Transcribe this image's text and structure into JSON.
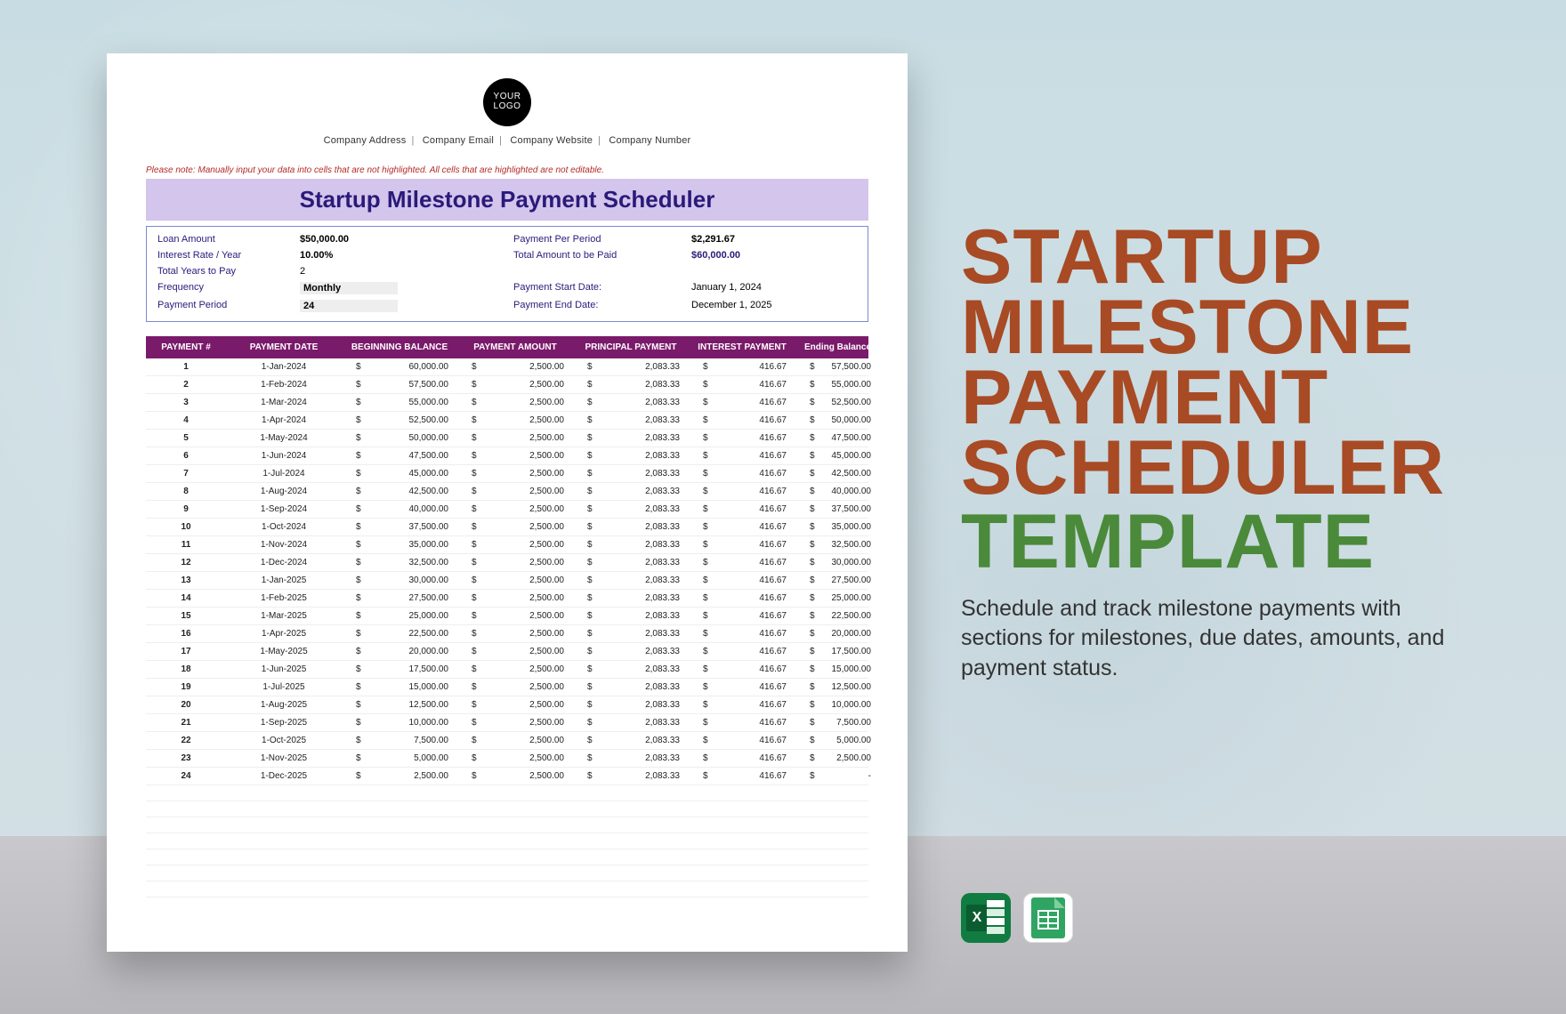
{
  "logo_text": "YOUR LOGO",
  "company_meta": [
    "Company Address",
    "Company Email",
    "Company Website",
    "Company Number"
  ],
  "note": "Please note: Manually input your data into cells that are not highlighted. All cells that are highlighted are not editable.",
  "sheet_title": "Startup Milestone Payment Scheduler",
  "summary": {
    "loan_amount_label": "Loan Amount",
    "loan_amount": "$50,000.00",
    "interest_label": "Interest Rate / Year",
    "interest": "10.00%",
    "years_label": "Total Years to Pay",
    "years": "2",
    "freq_label": "Frequency",
    "freq": "Monthly",
    "period_label": "Payment Period",
    "period": "24",
    "ppp_label": "Payment Per Period",
    "ppp": "$2,291.67",
    "total_label": "Total Amount to be Paid",
    "total": "$60,000.00",
    "start_label": "Payment Start Date:",
    "start": "January 1, 2024",
    "end_label": "Payment End Date:",
    "end": "December 1, 2025"
  },
  "columns": [
    "PAYMENT #",
    "PAYMENT DATE",
    "BEGINNING BALANCE",
    "PAYMENT AMOUNT",
    "PRINCIPAL PAYMENT",
    "INTEREST PAYMENT",
    "Ending Balance"
  ],
  "currency": "$",
  "rows": [
    {
      "n": "1",
      "date": "1-Jan-2024",
      "beg": "60,000.00",
      "pay": "2,500.00",
      "prin": "2,083.33",
      "int": "416.67",
      "end": "57,500.00"
    },
    {
      "n": "2",
      "date": "1-Feb-2024",
      "beg": "57,500.00",
      "pay": "2,500.00",
      "prin": "2,083.33",
      "int": "416.67",
      "end": "55,000.00"
    },
    {
      "n": "3",
      "date": "1-Mar-2024",
      "beg": "55,000.00",
      "pay": "2,500.00",
      "prin": "2,083.33",
      "int": "416.67",
      "end": "52,500.00"
    },
    {
      "n": "4",
      "date": "1-Apr-2024",
      "beg": "52,500.00",
      "pay": "2,500.00",
      "prin": "2,083.33",
      "int": "416.67",
      "end": "50,000.00"
    },
    {
      "n": "5",
      "date": "1-May-2024",
      "beg": "50,000.00",
      "pay": "2,500.00",
      "prin": "2,083.33",
      "int": "416.67",
      "end": "47,500.00"
    },
    {
      "n": "6",
      "date": "1-Jun-2024",
      "beg": "47,500.00",
      "pay": "2,500.00",
      "prin": "2,083.33",
      "int": "416.67",
      "end": "45,000.00"
    },
    {
      "n": "7",
      "date": "1-Jul-2024",
      "beg": "45,000.00",
      "pay": "2,500.00",
      "prin": "2,083.33",
      "int": "416.67",
      "end": "42,500.00"
    },
    {
      "n": "8",
      "date": "1-Aug-2024",
      "beg": "42,500.00",
      "pay": "2,500.00",
      "prin": "2,083.33",
      "int": "416.67",
      "end": "40,000.00"
    },
    {
      "n": "9",
      "date": "1-Sep-2024",
      "beg": "40,000.00",
      "pay": "2,500.00",
      "prin": "2,083.33",
      "int": "416.67",
      "end": "37,500.00"
    },
    {
      "n": "10",
      "date": "1-Oct-2024",
      "beg": "37,500.00",
      "pay": "2,500.00",
      "prin": "2,083.33",
      "int": "416.67",
      "end": "35,000.00"
    },
    {
      "n": "11",
      "date": "1-Nov-2024",
      "beg": "35,000.00",
      "pay": "2,500.00",
      "prin": "2,083.33",
      "int": "416.67",
      "end": "32,500.00"
    },
    {
      "n": "12",
      "date": "1-Dec-2024",
      "beg": "32,500.00",
      "pay": "2,500.00",
      "prin": "2,083.33",
      "int": "416.67",
      "end": "30,000.00"
    },
    {
      "n": "13",
      "date": "1-Jan-2025",
      "beg": "30,000.00",
      "pay": "2,500.00",
      "prin": "2,083.33",
      "int": "416.67",
      "end": "27,500.00"
    },
    {
      "n": "14",
      "date": "1-Feb-2025",
      "beg": "27,500.00",
      "pay": "2,500.00",
      "prin": "2,083.33",
      "int": "416.67",
      "end": "25,000.00"
    },
    {
      "n": "15",
      "date": "1-Mar-2025",
      "beg": "25,000.00",
      "pay": "2,500.00",
      "prin": "2,083.33",
      "int": "416.67",
      "end": "22,500.00"
    },
    {
      "n": "16",
      "date": "1-Apr-2025",
      "beg": "22,500.00",
      "pay": "2,500.00",
      "prin": "2,083.33",
      "int": "416.67",
      "end": "20,000.00"
    },
    {
      "n": "17",
      "date": "1-May-2025",
      "beg": "20,000.00",
      "pay": "2,500.00",
      "prin": "2,083.33",
      "int": "416.67",
      "end": "17,500.00"
    },
    {
      "n": "18",
      "date": "1-Jun-2025",
      "beg": "17,500.00",
      "pay": "2,500.00",
      "prin": "2,083.33",
      "int": "416.67",
      "end": "15,000.00"
    },
    {
      "n": "19",
      "date": "1-Jul-2025",
      "beg": "15,000.00",
      "pay": "2,500.00",
      "prin": "2,083.33",
      "int": "416.67",
      "end": "12,500.00"
    },
    {
      "n": "20",
      "date": "1-Aug-2025",
      "beg": "12,500.00",
      "pay": "2,500.00",
      "prin": "2,083.33",
      "int": "416.67",
      "end": "10,000.00"
    },
    {
      "n": "21",
      "date": "1-Sep-2025",
      "beg": "10,000.00",
      "pay": "2,500.00",
      "prin": "2,083.33",
      "int": "416.67",
      "end": "7,500.00"
    },
    {
      "n": "22",
      "date": "1-Oct-2025",
      "beg": "7,500.00",
      "pay": "2,500.00",
      "prin": "2,083.33",
      "int": "416.67",
      "end": "5,000.00"
    },
    {
      "n": "23",
      "date": "1-Nov-2025",
      "beg": "5,000.00",
      "pay": "2,500.00",
      "prin": "2,083.33",
      "int": "416.67",
      "end": "2,500.00"
    },
    {
      "n": "24",
      "date": "1-Dec-2025",
      "beg": "2,500.00",
      "pay": "2,500.00",
      "prin": "2,083.33",
      "int": "416.67",
      "end": "-"
    }
  ],
  "blank_rows": 7,
  "promo": {
    "line1": "STARTUP",
    "line2": "MILESTONE",
    "line3": "PAYMENT",
    "line4": "SCHEDULER",
    "template": "TEMPLATE",
    "sub": "Schedule and track milestone payments with sections for milestones, due dates, amounts, and payment status."
  }
}
